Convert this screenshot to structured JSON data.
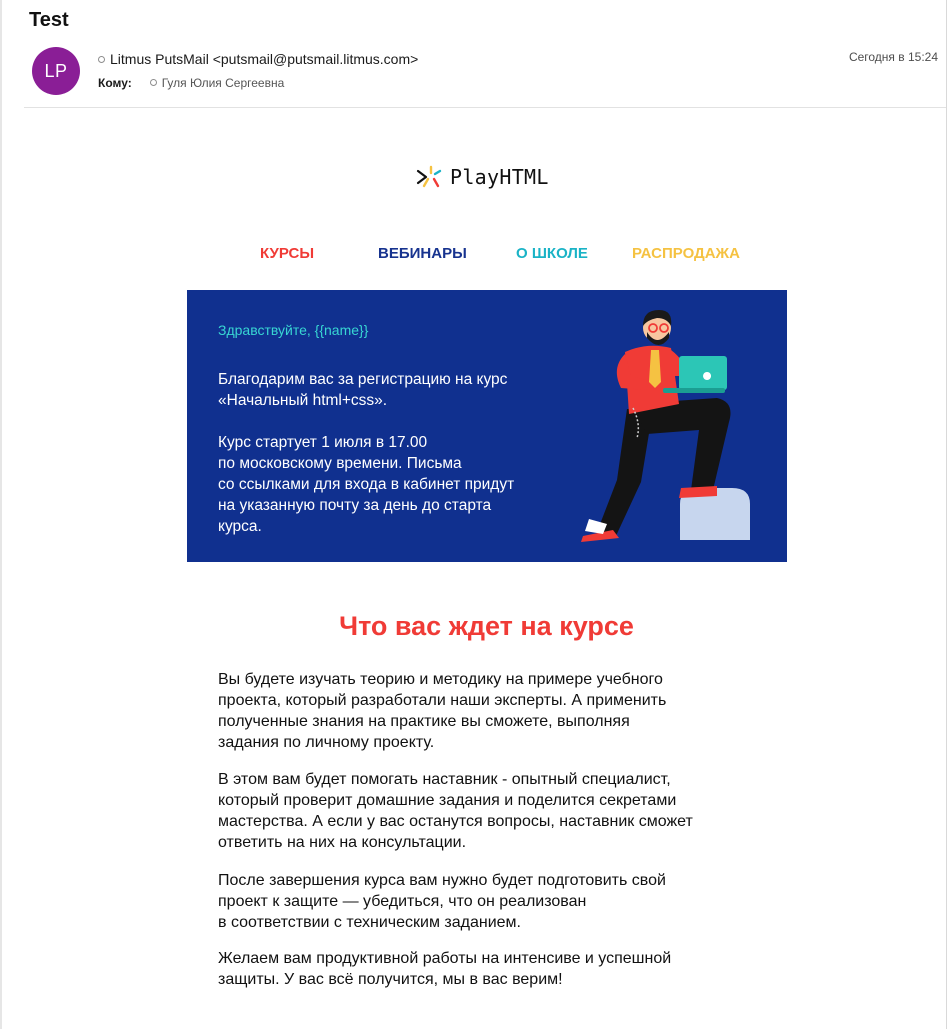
{
  "mail": {
    "subject": "Test",
    "avatar_initials": "LP",
    "sender": "Litmus PutsMail <putsmail@putsmail.litmus.com>",
    "to_label": "Кому:",
    "to_name": "Гуля Юлия Сергеевна",
    "date": "Сегодня в 15:24"
  },
  "brand": {
    "name": "PlayHTML",
    "icon": "playhtml-logo-icon"
  },
  "nav": {
    "items": [
      {
        "label": "КУРСЫ",
        "color": "#f03b36"
      },
      {
        "label": "ВЕБИНАРЫ",
        "color": "#17338f"
      },
      {
        "label": "О ШКОЛЕ",
        "color": "#1ab3c6"
      },
      {
        "label": "РАСПРОДАЖА",
        "color": "#f5c242"
      }
    ]
  },
  "hero": {
    "greeting": "Здравствуйте, {{name}}",
    "text": "Благодарим вас за регистрацию на курс\n«Начальный html+css».\n\nКурс стартует 1 июля в 17.00\nпо московскому времени. Письма\nсо ссылками для входа в кабинет придут\nна указанную почту за день до старта\nкурса.",
    "illustration": "developer-with-laptop-illustration"
  },
  "section": {
    "title": "Что вас ждет на курсе",
    "paragraphs": [
      "Вы будете изучать теорию и методику на примере учебного\nпроекта, который разработали наши эксперты. А применить\nполученные знания на практике вы сможете, выполняя\nзадания по личному проекту.",
      "В этом вам будет помогать наставник - опытный специалист,\nкоторый проверит домашние задания и поделится секретами\nмастерства. А если у вас останутся вопросы, наставник сможет\nответить на них на консультации.",
      "После завершения курса вам нужно будет подготовить свой\nпроект к защите — убедиться, что он реализован\nв соответствии с техническим заданием.",
      "Желаем вам продуктивной работы на интенсиве и успешной\nзащиты. У вас всё получится, мы в вас верим!"
    ]
  },
  "colors": {
    "avatar_bg": "#8a1e96",
    "hero_bg": "#10308f",
    "greeting": "#38d6d3",
    "section_title": "#f03b36"
  }
}
